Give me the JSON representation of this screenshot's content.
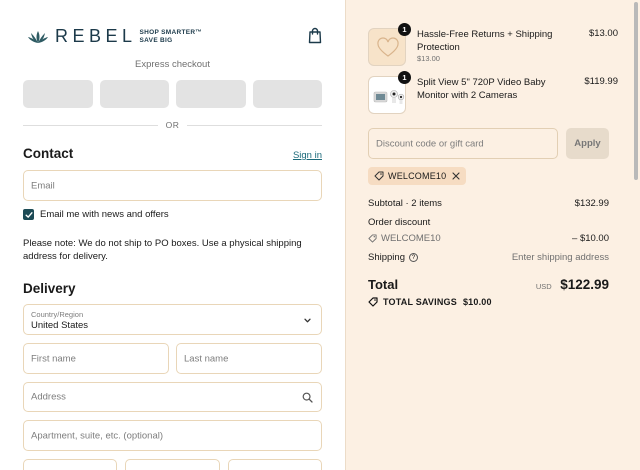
{
  "brand": {
    "name": "REBEL",
    "tagline": "SHOP SMARTER™\nSAVE BIG"
  },
  "checkout": {
    "express_label": "Express checkout",
    "or_label": "OR",
    "contact_heading": "Contact",
    "signin_label": "Sign in",
    "email_placeholder": "Email",
    "newsletter_label": "Email me with news and offers",
    "newsletter_checked": true,
    "po_note": "Please note: We do not ship to PO boxes. Use a physical shipping address for delivery.",
    "delivery_heading": "Delivery",
    "country_label": "Country/Region",
    "country_value": "United States",
    "first_name_placeholder": "First name",
    "last_name_placeholder": "Last name",
    "address_placeholder": "Address",
    "apartment_placeholder": "Apartment, suite, etc. (optional)"
  },
  "summary": {
    "items": [
      {
        "name": "Hassle-Free Returns + Shipping Protection",
        "sub": "$13.00",
        "price": "$13.00",
        "qty": "1",
        "icon": "heart-icon"
      },
      {
        "name": "Split View 5\" 720P Video Baby Monitor with 2 Cameras",
        "sub": "",
        "price": "$119.99",
        "qty": "1",
        "icon": "baby-monitor-product-image"
      }
    ],
    "discount_placeholder": "Discount code or gift card",
    "apply_label": "Apply",
    "applied_code": "WELCOME10",
    "subtotal_label": "Subtotal · 2 items",
    "subtotal_value": "$132.99",
    "order_discount_label": "Order discount",
    "discount_code": "WELCOME10",
    "discount_value": "– $10.00",
    "shipping_label": "Shipping",
    "shipping_value": "Enter shipping address",
    "total_label": "Total",
    "currency": "USD",
    "total_value": "$122.99",
    "savings_label": "TOTAL SAVINGS",
    "savings_value": "$10.00"
  },
  "colors": {
    "summary_bg": "#fcf0e3",
    "accent": "#1c4a55",
    "field_border": "#e9d6b8"
  }
}
